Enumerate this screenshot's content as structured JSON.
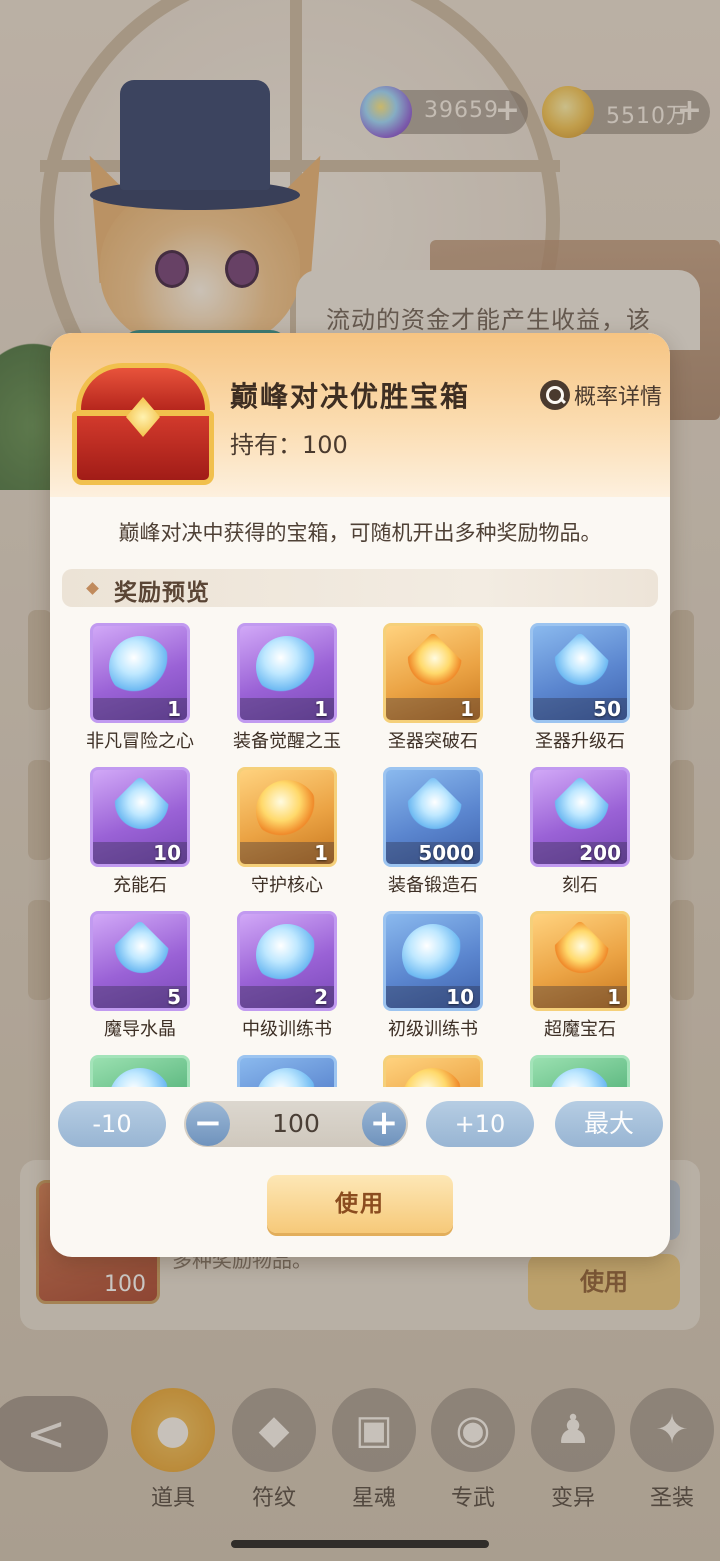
{
  "currency": {
    "gems": "39659",
    "gold": "5510万",
    "plus": "+"
  },
  "background": {
    "speech_text": "流动的资金才能产生收益，该",
    "card_text": "多种奖励物品。",
    "card_count": "100",
    "card_use": "使用"
  },
  "modal": {
    "title": "巅峰对决优胜宝箱",
    "held": "持有：100",
    "probability_link": "概率详情",
    "description": "巅峰对决中获得的宝箱，可随机开出多种奖励物品。",
    "section_title": "奖励预览",
    "rewards": [
      {
        "name": "非凡冒险之心",
        "qty": "1",
        "rarity": "purple",
        "icon": "orb-heart-icon"
      },
      {
        "name": "装备觉醒之玉",
        "qty": "1",
        "rarity": "purple",
        "icon": "orb-jade-icon"
      },
      {
        "name": "圣器突破石",
        "qty": "1",
        "rarity": "gold",
        "icon": "flame-stone-icon"
      },
      {
        "name": "圣器升级石",
        "qty": "50",
        "rarity": "blue",
        "icon": "spirit-stone-icon"
      },
      {
        "name": "充能石",
        "qty": "10",
        "rarity": "purple",
        "icon": "crystal-cluster-icon"
      },
      {
        "name": "守护核心",
        "qty": "1",
        "rarity": "gold",
        "icon": "guardian-core-icon"
      },
      {
        "name": "装备锻造石",
        "qty": "5000",
        "rarity": "blue",
        "icon": "forge-stone-icon"
      },
      {
        "name": "刻石",
        "qty": "200",
        "rarity": "purple",
        "icon": "rune-crystal-icon"
      },
      {
        "name": "魔导水晶",
        "qty": "5",
        "rarity": "purple",
        "icon": "magic-crystal-icon"
      },
      {
        "name": "中级训练书",
        "qty": "2",
        "rarity": "purple",
        "icon": "book-icon"
      },
      {
        "name": "初级训练书",
        "qty": "10",
        "rarity": "blue",
        "icon": "book-icon"
      },
      {
        "name": "超魔宝石",
        "qty": "1",
        "rarity": "gold",
        "icon": "gemstone-icon"
      },
      {
        "name": "",
        "qty": "",
        "rarity": "green",
        "icon": "partial-item-icon"
      },
      {
        "name": "",
        "qty": "",
        "rarity": "blue",
        "icon": "partial-item-icon"
      },
      {
        "name": "",
        "qty": "",
        "rarity": "gold",
        "icon": "partial-item-icon"
      },
      {
        "name": "",
        "qty": "",
        "rarity": "green",
        "icon": "partial-item-icon"
      }
    ],
    "controls": {
      "minus10": "-10",
      "quantity": "100",
      "plus10": "+10",
      "max": "最大",
      "dec_symbol": "−",
      "inc_symbol": "+"
    },
    "use_button": "使用"
  },
  "nav": {
    "back_symbol": "<",
    "tabs": [
      {
        "label": "道具",
        "icon": "bag-icon",
        "active": true
      },
      {
        "label": "符纹",
        "icon": "rune-icon",
        "active": false
      },
      {
        "label": "星魂",
        "icon": "star-card-icon",
        "active": false
      },
      {
        "label": "专武",
        "icon": "weapon-icon",
        "active": false
      },
      {
        "label": "变异",
        "icon": "mutation-icon",
        "active": false
      },
      {
        "label": "圣装",
        "icon": "holy-gear-icon",
        "active": false
      }
    ]
  }
}
